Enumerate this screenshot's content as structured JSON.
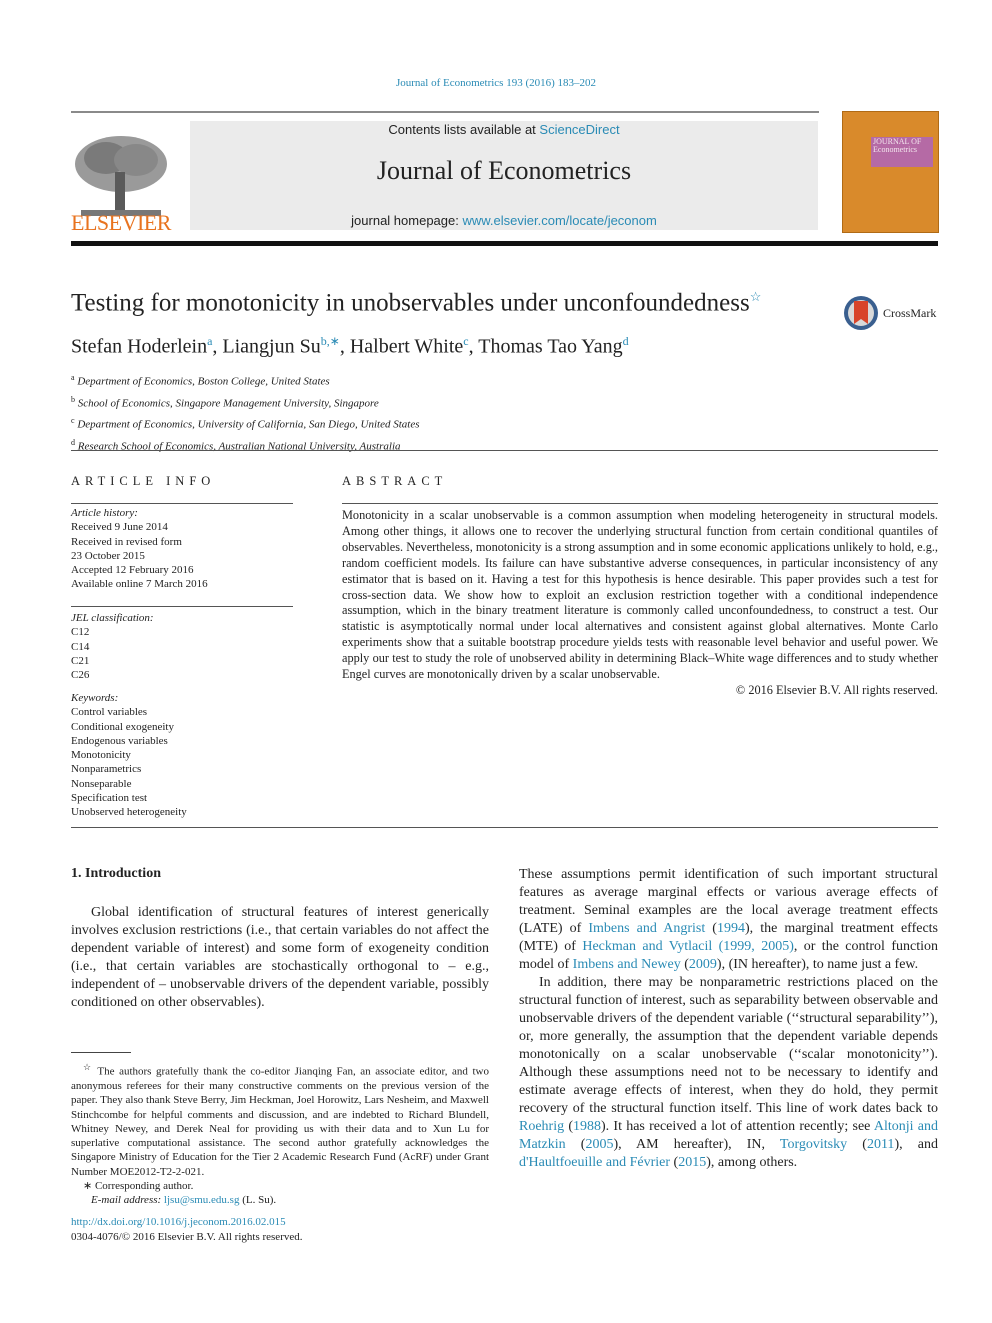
{
  "header": {
    "citation": "Journal of Econometrics 193 (2016) 183–202",
    "contents_prefix": "Contents lists available at ",
    "contents_link": "ScienceDirect",
    "journal_title": "Journal of Econometrics",
    "homepage_prefix": "journal homepage: ",
    "homepage_link": "www.elsevier.com/locate/jeconom",
    "publisher": "ELSEVIER",
    "cover_title_line1": "JOURNAL OF",
    "cover_title_line2": "Econometrics",
    "crossmark_label": "CrossMark"
  },
  "article": {
    "title": "Testing for monotonicity in unobservables under unconfoundedness",
    "title_mark": "☆",
    "authors": [
      {
        "name": "Stefan Hoderlein",
        "sup": "a"
      },
      {
        "name": "Liangjun Su",
        "sup": "b,∗"
      },
      {
        "name": "Halbert White",
        "sup": "c"
      },
      {
        "name": "Thomas Tao Yang",
        "sup": "d"
      }
    ],
    "affiliations": [
      {
        "sup": "a",
        "text": "Department of Economics, Boston College, United States"
      },
      {
        "sup": "b",
        "text": "School of Economics, Singapore Management University, Singapore"
      },
      {
        "sup": "c",
        "text": "Department of Economics, University of California, San Diego, United States"
      },
      {
        "sup": "d",
        "text": "Research School of Economics, Australian National University, Australia"
      }
    ]
  },
  "article_info": {
    "heading": "ARTICLE INFO",
    "history_label": "Article history:",
    "history": [
      "Received 9 June 2014",
      "Received in revised form",
      "23 October 2015",
      "Accepted 12 February 2016",
      "Available online 7 March 2016"
    ],
    "jel_label": "JEL classification:",
    "jel": [
      "C12",
      "C14",
      "C21",
      "C26"
    ],
    "keywords_label": "Keywords:",
    "keywords": [
      "Control variables",
      "Conditional exogeneity",
      "Endogenous variables",
      "Monotonicity",
      "Nonparametrics",
      "Nonseparable",
      "Specification test",
      "Unobserved heterogeneity"
    ]
  },
  "abstract": {
    "heading": "ABSTRACT",
    "text": "Monotonicity in a scalar unobservable is a common assumption when modeling heterogeneity in structural models. Among other things, it allows one to recover the underlying structural function from certain conditional quantiles of observables. Nevertheless, monotonicity is a strong assumption and in some economic applications unlikely to hold, e.g., random coefficient models. Its failure can have substantive adverse consequences, in particular inconsistency of any estimator that is based on it. Having a test for this hypothesis is hence desirable. This paper provides such a test for cross-section data. We show how to exploit an exclusion restriction together with a conditional independence assumption, which in the binary treatment literature is commonly called unconfoundedness, to construct a test. Our statistic is asymptotically normal under local alternatives and consistent against global alternatives. Monte Carlo experiments show that a suitable bootstrap procedure yields tests with reasonable level behavior and useful power. We apply our test to study the role of unobserved ability in determining Black–White wage differences and to study whether Engel curves are monotonically driven by a scalar unobservable.",
    "copyright": "© 2016 Elsevier B.V. All rights reserved."
  },
  "intro": {
    "heading": "1.  Introduction",
    "para1": "Global identification of structural features of interest generically involves exclusion restrictions (i.e., that certain variables do not affect the dependent variable of interest) and some form of exogeneity condition (i.e., that certain variables are stochastically orthogonal to – e.g., independent of – unobservable drivers of the dependent variable, possibly conditioned on other observables).",
    "para2": {
      "t1": "These assumptions permit identification of such important structural features as average marginal effects or various average effects of treatment. Seminal examples are the local average treatment effects (LATE) of ",
      "l1": "Imbens and Angrist",
      "t2": " (",
      "l1y": "1994",
      "t3": "), the marginal treatment effects (MTE) of ",
      "l2": "Heckman and Vytlacil (1999, 2005)",
      "t4": ", or the control function model of ",
      "l3": "Imbens and Newey",
      "t5": " (",
      "l3y": "2009",
      "t6": "), (IN hereafter), to name just a few."
    },
    "para3": {
      "t1": "In addition, there may be nonparametric restrictions placed on the structural function of interest, such as separability between observable and unobservable drivers of the dependent variable (‘‘structural separability’’), or, more generally, the assumption that the dependent variable depends monotonically on a scalar unobservable (‘‘scalar monotonicity’’). Although these assumptions need not to be necessary to identify and estimate average effects of interest, when they do hold, they permit recovery of the structural function itself. This line of work dates back to ",
      "l1": "Roehrig",
      "t2": " (",
      "l1y": "1988",
      "t3": "). It has received a lot of attention recently; see ",
      "l2": "Altonji and Matzkin",
      "t4": " (",
      "l2y": "2005",
      "t5": "), AM hereafter), IN, ",
      "l3": "Torgovitsky",
      "t6": " (",
      "l3y": "2011",
      "t7": "), and ",
      "l4": "d'Haultfoeuille and Février",
      "t8": " (",
      "l4y": "2015",
      "t9": "), among others."
    }
  },
  "footnotes": {
    "star_mark": "☆",
    "star_text": "The authors gratefully thank the co-editor Jianqing Fan, an associate editor, and two anonymous referees for their many constructive comments on the previous version of the paper. They also thank Steve Berry, Jim Heckman, Joel Horowitz, Lars Nesheim, and Maxwell Stinchcombe for helpful comments and discussion, and are indebted to Richard Blundell, Whitney Newey, and Derek Neal for providing us with their data and to Xun Lu for superlative computational assistance. The second author gratefully acknowledges the Singapore Ministry of Education for the Tier 2 Academic Research Fund (AcRF) under Grant Number MOE2012-T2-2-021.",
    "corr_mark": "∗",
    "corr_text": "Corresponding author.",
    "email_label": "E-mail address: ",
    "email": "ljsu@smu.edu.sg",
    "email_suffix": " (L. Su).",
    "doi": "http://dx.doi.org/10.1016/j.jeconom.2016.02.015",
    "issn": "0304-4076/© 2016 Elsevier B.V. All rights reserved."
  }
}
